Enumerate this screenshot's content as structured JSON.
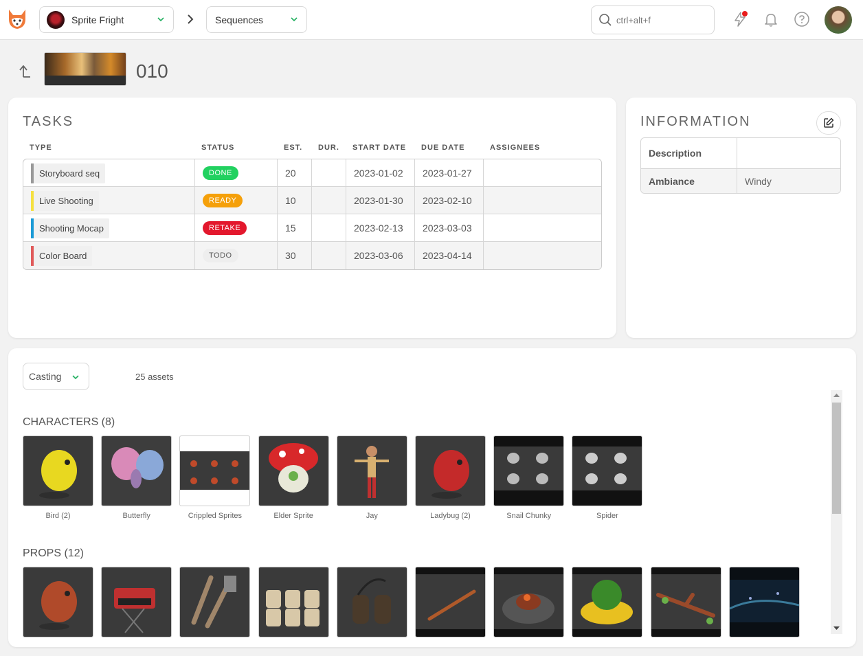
{
  "topbar": {
    "production": "Sprite Fright",
    "section": "Sequences",
    "search_placeholder": "ctrl+alt+f",
    "icons": [
      "kitsu-logo-icon",
      "chevron-down-icon",
      "chevron-right-icon",
      "search-icon",
      "news-icon",
      "bell-icon",
      "help-icon",
      "user-avatar"
    ]
  },
  "header": {
    "title": "010"
  },
  "tasks": {
    "title": "TASKS",
    "columns": [
      "TYPE",
      "STATUS",
      "EST.",
      "DUR.",
      "START DATE",
      "DUE DATE",
      "ASSIGNEES"
    ],
    "rows": [
      {
        "type": "Storyboard seq",
        "type_color": "#999999",
        "status": "DONE",
        "status_color": "#22d160",
        "status_text_color": "#ffffff",
        "est": "20",
        "dur": "",
        "start": "2023-01-02",
        "due": "2023-01-27",
        "assignees": ""
      },
      {
        "type": "Live Shooting",
        "type_color": "#f5e040",
        "status": "READY",
        "status_color": "#f5a00a",
        "status_text_color": "#ffffff",
        "est": "10",
        "dur": "",
        "start": "2023-01-30",
        "due": "2023-02-10",
        "assignees": ""
      },
      {
        "type": "Shooting Mocap",
        "type_color": "#1a9ad6",
        "status": "RETAKE",
        "status_color": "#e3182d",
        "status_text_color": "#ffffff",
        "est": "15",
        "dur": "",
        "start": "2023-02-13",
        "due": "2023-03-03",
        "assignees": ""
      },
      {
        "type": "Color Board",
        "type_color": "#e05a5a",
        "status": "TODO",
        "status_color": "#eeeeee",
        "status_text_color": "#555555",
        "est": "30",
        "dur": "",
        "start": "2023-03-06",
        "due": "2023-04-14",
        "assignees": ""
      }
    ]
  },
  "information": {
    "title": "INFORMATION",
    "rows": [
      {
        "key": "Description",
        "value": ""
      },
      {
        "key": "Ambiance",
        "value": "Windy"
      }
    ]
  },
  "casting": {
    "select": "Casting",
    "count": "25 assets",
    "characters": {
      "title": "CHARACTERS (8)",
      "items": [
        {
          "name": "Bird (2)",
          "bg": "#3a3a3a",
          "fg": "#e8d820",
          "shape": "blob"
        },
        {
          "name": "Butterfly",
          "bg": "#3d3d3d",
          "fg": "#d98ab8",
          "shape": "wings"
        },
        {
          "name": "Crippled Sprites",
          "bg": "#ffffff",
          "fg": "#444444",
          "shape": "grid"
        },
        {
          "name": "Elder Sprite",
          "bg": "#3a3a3a",
          "fg": "#d8282a",
          "shape": "mushroom"
        },
        {
          "name": "Jay",
          "bg": "#3a3a3a",
          "fg": "#d8b070",
          "shape": "figure"
        },
        {
          "name": "Ladybug (2)",
          "bg": "#3b3b3b",
          "fg": "#c42a2a",
          "shape": "blob"
        },
        {
          "name": "Snail Chunky",
          "bg": "#111111",
          "fg": "#bbbbbb",
          "shape": "grid-dark"
        },
        {
          "name": "Spider",
          "bg": "#111111",
          "fg": "#cccccc",
          "shape": "grid-dark"
        }
      ]
    },
    "props": {
      "title": "PROPS (12)",
      "items": [
        {
          "name": "",
          "bg": "#3a3a3a",
          "fg": "#b04a2a",
          "shape": "blob"
        },
        {
          "name": "",
          "bg": "#3a3a3a",
          "fg": "#c03030",
          "shape": "box"
        },
        {
          "name": "",
          "bg": "#3a3a3a",
          "fg": "#a0866a",
          "shape": "tools"
        },
        {
          "name": "",
          "bg": "#3a3a3a",
          "fg": "#d8c8a8",
          "shape": "cans"
        },
        {
          "name": "",
          "bg": "#3a3a3a",
          "fg": "#4a3a2a",
          "shape": "binoculars"
        },
        {
          "name": "",
          "bg": "#111111",
          "fg": "#b05a2a",
          "shape": "stick"
        },
        {
          "name": "",
          "bg": "#111111",
          "fg": "#8a3a20",
          "shape": "fire"
        },
        {
          "name": "",
          "bg": "#111111",
          "fg": "#e8c020",
          "shape": "flower"
        },
        {
          "name": "",
          "bg": "#111111",
          "fg": "#9a4a2a",
          "shape": "branch"
        },
        {
          "name": "",
          "bg": "#0a0f14",
          "fg": "#3a7a9a",
          "shape": "night"
        }
      ]
    }
  }
}
